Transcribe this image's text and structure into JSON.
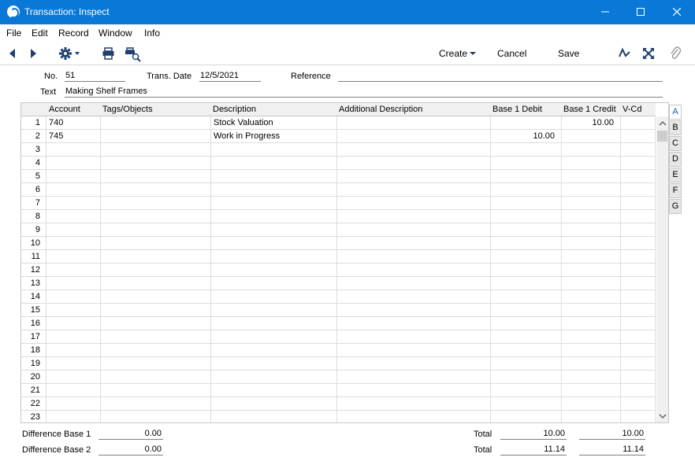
{
  "window": {
    "title": "Transaction: Inspect"
  },
  "menu": [
    "File",
    "Edit",
    "Record",
    "Window",
    "Info"
  ],
  "toolbar": {
    "create_label": "Create",
    "cancel_label": "Cancel",
    "save_label": "Save"
  },
  "header": {
    "no_label": "No.",
    "no_value": "51",
    "date_label": "Trans. Date",
    "date_value": "12/5/2021",
    "reference_label": "Reference",
    "reference_value": "",
    "text_label": "Text",
    "text_value": "Making Shelf Frames"
  },
  "grid": {
    "columns": [
      "Account",
      "Tags/Objects",
      "Description",
      "Additional Description",
      "Base 1 Debit",
      "Base 1 Credit",
      "V-Cd"
    ],
    "rows": [
      {
        "n": "1",
        "account": "740",
        "tags": "",
        "description": "Stock Valuation",
        "additional": "",
        "debit": "",
        "credit": "10.00",
        "vcd": ""
      },
      {
        "n": "2",
        "account": "745",
        "tags": "",
        "description": "Work in Progress",
        "additional": "",
        "debit": "10.00",
        "credit": "",
        "vcd": ""
      },
      {
        "n": "3"
      },
      {
        "n": "4"
      },
      {
        "n": "5"
      },
      {
        "n": "6"
      },
      {
        "n": "7"
      },
      {
        "n": "8"
      },
      {
        "n": "9"
      },
      {
        "n": "10"
      },
      {
        "n": "11"
      },
      {
        "n": "12"
      },
      {
        "n": "13"
      },
      {
        "n": "14"
      },
      {
        "n": "15"
      },
      {
        "n": "16"
      },
      {
        "n": "17"
      },
      {
        "n": "18"
      },
      {
        "n": "19"
      },
      {
        "n": "20"
      },
      {
        "n": "21"
      },
      {
        "n": "22"
      },
      {
        "n": "23"
      }
    ]
  },
  "tabs": [
    "A",
    "B",
    "C",
    "D",
    "E",
    "F",
    "G"
  ],
  "footer": {
    "diff1_label": "Difference Base 1",
    "diff1_value": "0.00",
    "diff2_label": "Difference Base 2",
    "diff2_value": "0.00",
    "total_label": "Total",
    "total1_debit": "10.00",
    "total1_credit": "10.00",
    "total2_debit": "11.14",
    "total2_credit": "11.14"
  }
}
